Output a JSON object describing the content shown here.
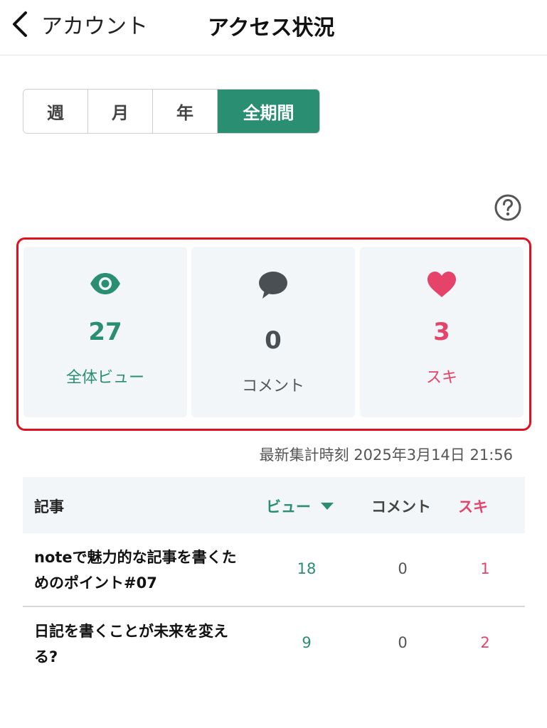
{
  "header": {
    "back_label": "アカウント",
    "title": "アクセス状況"
  },
  "period_tabs": [
    {
      "label": "週",
      "active": false
    },
    {
      "label": "月",
      "active": false
    },
    {
      "label": "年",
      "active": false
    },
    {
      "label": "全期間",
      "active": true
    }
  ],
  "stats": {
    "views": {
      "value": "27",
      "label": "全体ビュー",
      "icon": "eye-icon",
      "color": "#2a8f72"
    },
    "comments": {
      "value": "0",
      "label": "コメント",
      "icon": "speech-bubble-icon",
      "color": "#4a4f54"
    },
    "likes": {
      "value": "3",
      "label": "スキ",
      "icon": "heart-icon",
      "color": "#e5436a"
    }
  },
  "updated_at": "最新集計時刻 2025年3月14日 21:56",
  "table": {
    "headers": {
      "article": "記事",
      "views": "ビュー",
      "comments": "コメント",
      "likes": "スキ"
    },
    "rows": [
      {
        "title": "noteで魅力的な記事を書くためのポイント#07",
        "views": "18",
        "comments": "0",
        "likes": "1"
      },
      {
        "title": "日記を書くことが未来を変える?",
        "views": "9",
        "comments": "0",
        "likes": "2"
      }
    ]
  },
  "colors": {
    "accent": "#2a8f72",
    "like": "#e5436a",
    "highlight_border": "#e0101e"
  }
}
